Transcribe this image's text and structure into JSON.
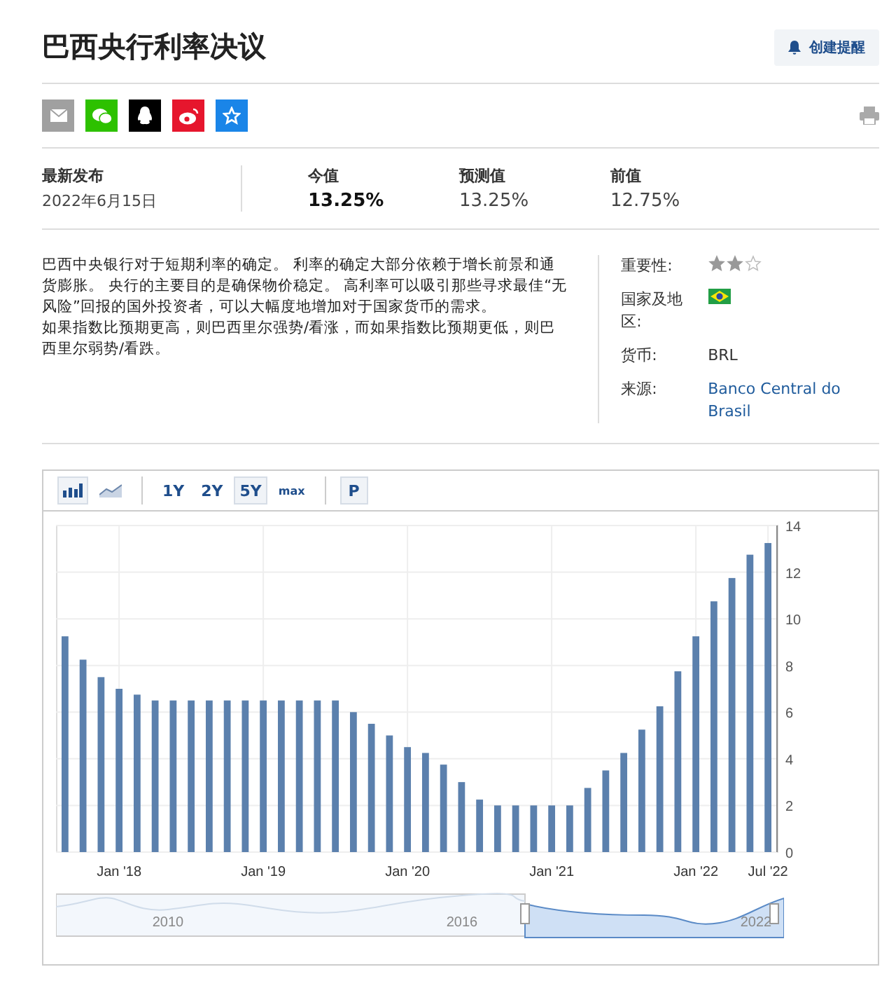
{
  "title": "巴西央行利率决议",
  "alert_button": "创建提醒",
  "share_icons": [
    {
      "kind": "email",
      "color": "#a0a0a0"
    },
    {
      "kind": "wechat",
      "color": "#2dc100"
    },
    {
      "kind": "qq",
      "color": "#000000"
    },
    {
      "kind": "weibo",
      "color": "#e6162d"
    },
    {
      "kind": "favorite",
      "color": "#1a85e8"
    }
  ],
  "release": {
    "label": "最新发布",
    "date": "2022年6月15日"
  },
  "values": [
    {
      "label": "今值",
      "value": "13.25%",
      "kind": "actual"
    },
    {
      "label": "预测值",
      "value": "13.25%",
      "kind": "forecast"
    },
    {
      "label": "前值",
      "value": "12.75%",
      "kind": "previous"
    }
  ],
  "description": [
    "巴西中央银行对于短期利率的确定。 利率的确定大部分依赖于增长前景和通货膨胀。 央行的主要目的是确保物价稳定。 高利率可以吸引那些寻求最佳“无风险”回报的国外投资者，可以大幅度地增加对于国家货币的需求。",
    "如果指数比预期更高，则巴西里尔强势/看涨，而如果指数比预期更低，则巴西里尔弱势/看跌。"
  ],
  "details": [
    {
      "label": "重要性:",
      "kind": "stars",
      "stars": 2
    },
    {
      "label": "国家及地区:",
      "kind": "flag"
    },
    {
      "label": "货币:",
      "kind": "text",
      "value": "BRL"
    },
    {
      "label": "来源:",
      "kind": "link",
      "value": "Banco Central do Brasil"
    }
  ],
  "chart_toolbar": {
    "types": [
      {
        "kind": "bar",
        "selected": true
      },
      {
        "kind": "line",
        "selected": false
      }
    ],
    "ranges": [
      {
        "label": "1Y",
        "selected": false
      },
      {
        "label": "2Y",
        "selected": false
      },
      {
        "label": "5Y",
        "selected": true
      },
      {
        "label": "max",
        "selected": false
      }
    ],
    "extra": {
      "label": "P",
      "selected": true
    }
  },
  "chart_data": {
    "type": "bar",
    "categories": [
      null,
      null,
      null,
      "Jan '18",
      null,
      null,
      null,
      null,
      null,
      null,
      null,
      "Jan '19",
      null,
      null,
      null,
      null,
      null,
      null,
      null,
      "Jan '20",
      null,
      null,
      null,
      null,
      null,
      null,
      null,
      "Jan '21",
      null,
      null,
      null,
      null,
      null,
      null,
      null,
      "Jan '22",
      null,
      null,
      null,
      "Jul '22"
    ],
    "series": [
      {
        "color": "#5b80ad",
        "values": [
          9.25,
          8.25,
          7.5,
          7.0,
          6.75,
          6.5,
          6.5,
          6.5,
          6.5,
          6.5,
          6.5,
          6.5,
          6.5,
          6.5,
          6.5,
          6.5,
          6.0,
          5.5,
          5.0,
          4.5,
          4.25,
          3.75,
          3.0,
          2.25,
          2.0,
          2.0,
          2.0,
          2.0,
          2.0,
          2.75,
          3.5,
          4.25,
          5.25,
          6.25,
          7.75,
          9.25,
          10.75,
          11.75,
          12.75,
          13.25
        ]
      }
    ],
    "ylim": [
      0,
      14
    ],
    "grid": true,
    "yticks": [
      0,
      2,
      4,
      6,
      8,
      10,
      12,
      14
    ]
  },
  "navigator": {
    "labels": [
      "2010",
      "2016",
      "2022"
    ]
  }
}
